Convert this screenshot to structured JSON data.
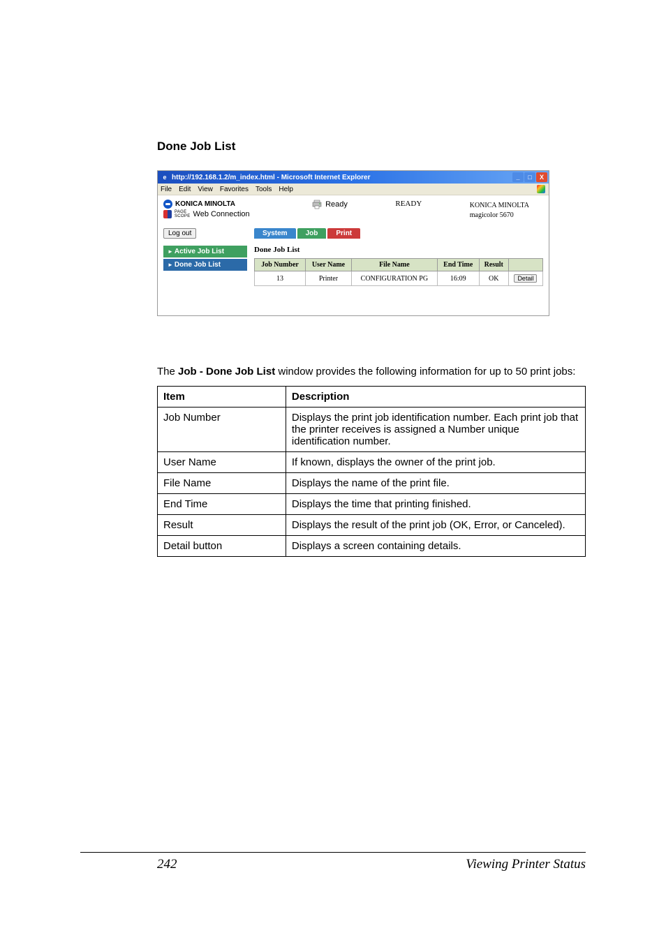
{
  "section_title": "Done Job List",
  "ie": {
    "title": "http://192.168.1.2/m_index.html - Microsoft Internet Explorer",
    "menu": {
      "file": "File",
      "edit": "Edit",
      "view": "View",
      "favorites": "Favorites",
      "tools": "Tools",
      "help": "Help"
    },
    "brand": {
      "name": "KONICA MINOLTA",
      "ps_small": "PAGE\nSCOPE",
      "sub": "Web Connection"
    },
    "status_label": "Ready",
    "ready_center": "READY",
    "model": {
      "line1": "KONICA MINOLTA",
      "line2": "magicolor 5670"
    },
    "logout": "Log out",
    "tabs": {
      "system": "System",
      "job": "Job",
      "print": "Print"
    },
    "side": {
      "active": "Active Job List",
      "done": "Done Job List"
    },
    "panel_title": "Done Job List",
    "job_table": {
      "headers": {
        "num": "Job Number",
        "user": "User Name",
        "file": "File Name",
        "end": "End Time",
        "result": "Result"
      },
      "rows": [
        {
          "num": "13",
          "user": "Printer",
          "file": "CONFIGURATION PG",
          "end": "16:09",
          "result": "OK",
          "detail": "Detail"
        }
      ]
    }
  },
  "body_text": {
    "pre": "The ",
    "bold": "Job - Done Job List",
    "post": " window provides the following information for up to 50 print jobs:"
  },
  "desc_table": {
    "headers": {
      "item": "Item",
      "description": "Description"
    },
    "rows": [
      {
        "item": "Job Number",
        "desc": "Displays the print job identification number. Each print job that the printer receives is assigned a Number unique identification number."
      },
      {
        "item": "User Name",
        "desc": "If known, displays the owner of the print job."
      },
      {
        "item": "File Name",
        "desc": "Displays the name of the print file."
      },
      {
        "item": "End Time",
        "desc": "Displays the time that printing finished."
      },
      {
        "item": "Result",
        "desc": "Displays the result of the print job (OK, Error, or Canceled)."
      },
      {
        "item": "Detail button",
        "desc": "Displays a screen containing details."
      }
    ]
  },
  "footer": {
    "page": "242",
    "label": "Viewing Printer Status"
  }
}
